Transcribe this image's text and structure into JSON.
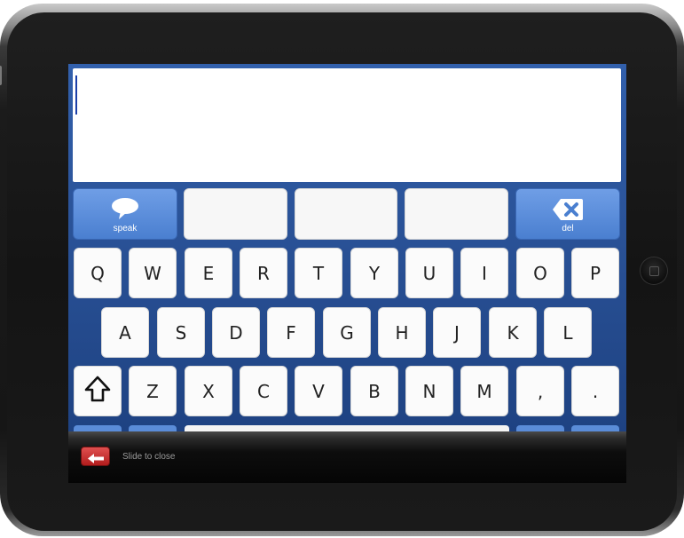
{
  "textarea": {
    "value": ""
  },
  "function_row": {
    "speak_label": "speak",
    "speak_icon": "speech-bubble-icon",
    "del_label": "del",
    "del_icon": "backspace-icon",
    "suggestions": [
      "",
      "",
      ""
    ]
  },
  "keyboard": {
    "row1": [
      "Q",
      "W",
      "E",
      "R",
      "T",
      "Y",
      "U",
      "I",
      "O",
      "P"
    ],
    "row2": [
      "A",
      "S",
      "D",
      "F",
      "G",
      "H",
      "J",
      "K",
      "L"
    ],
    "row3": [
      "Z",
      "X",
      "C",
      "V",
      "B",
      "N",
      "M",
      ",",
      "."
    ],
    "shift_icon": "shift-arrow-icon"
  },
  "slide_bar": {
    "label": "Slide to close",
    "icon": "back-arrow-icon"
  },
  "colors": {
    "keyboard_bg": "#2a5297",
    "key_bg": "#fbfbfb",
    "function_key_blue": "#5a8cd8",
    "close_handle": "#c62a2a"
  }
}
